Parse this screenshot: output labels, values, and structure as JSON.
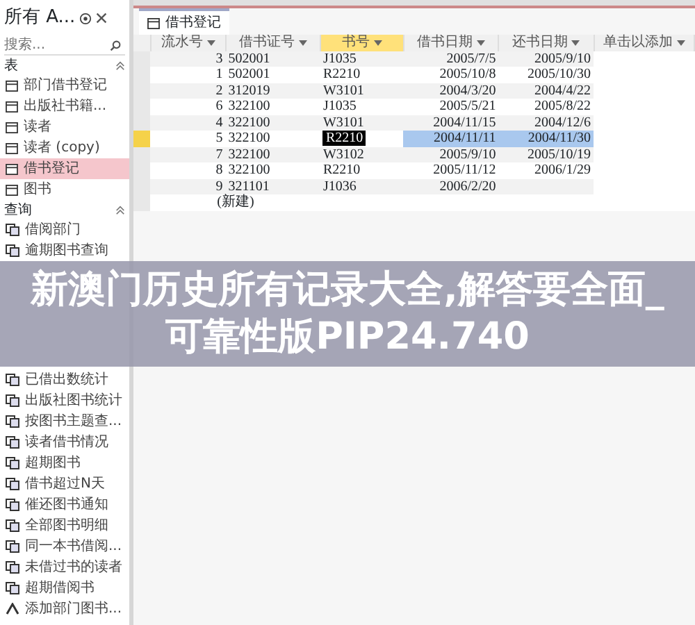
{
  "nav_pane": {
    "title": "所有 A...",
    "search": {
      "placeholder": "搜索..."
    },
    "groups": [
      {
        "label": "表",
        "expanded": true,
        "items": [
          {
            "label": "部门借书登记",
            "kind": "table",
            "selected": false
          },
          {
            "label": "出版社书籍...",
            "kind": "table",
            "selected": false
          },
          {
            "label": "读者",
            "kind": "table",
            "selected": false
          },
          {
            "label": "读者 (copy)",
            "kind": "table",
            "selected": false
          },
          {
            "label": "借书登记",
            "kind": "table",
            "selected": true
          },
          {
            "label": "图书",
            "kind": "table",
            "selected": false
          }
        ]
      },
      {
        "label": "查询",
        "expanded": true,
        "items": [
          {
            "label": "借阅部门",
            "kind": "query",
            "selected": false
          },
          {
            "label": "逾期图书查询",
            "kind": "query",
            "selected": false
          },
          {
            "label": "已借出数统计",
            "kind": "query",
            "selected": false
          },
          {
            "label": "出版社图书统计",
            "kind": "query",
            "selected": false
          },
          {
            "label": "按图书主题查...",
            "kind": "query",
            "selected": false
          },
          {
            "label": "读者借书情况",
            "kind": "query",
            "selected": false
          },
          {
            "label": "超期图书",
            "kind": "query",
            "selected": false
          },
          {
            "label": "借书超过N天",
            "kind": "query",
            "selected": false
          },
          {
            "label": "催还图书通知",
            "kind": "query",
            "selected": false
          },
          {
            "label": "全部图书明细",
            "kind": "query",
            "selected": false
          },
          {
            "label": "同一本书借阅...",
            "kind": "query",
            "selected": false
          },
          {
            "label": "未借过书的读者",
            "kind": "query",
            "selected": false
          },
          {
            "label": "超期借阅书",
            "kind": "query",
            "selected": false
          },
          {
            "label": "添加部门图书...",
            "kind": "action",
            "selected": false
          }
        ]
      }
    ]
  },
  "document_tab": {
    "label": "借书登记"
  },
  "table": {
    "columns": [
      {
        "label": "流水号",
        "selected": false
      },
      {
        "label": "借书证号",
        "selected": false
      },
      {
        "label": "书号",
        "selected": true
      },
      {
        "label": "借书日期",
        "selected": false
      },
      {
        "label": "还书日期",
        "selected": false
      },
      {
        "label": "单击以添加",
        "selected": false
      }
    ],
    "rows": [
      {
        "cells": [
          "3",
          "502001",
          "J1035",
          "2005/7/5",
          "2005/9/10"
        ],
        "selected": false
      },
      {
        "cells": [
          "1",
          "502001",
          "R2210",
          "2005/10/8",
          "2005/10/30"
        ],
        "selected": false
      },
      {
        "cells": [
          "2",
          "312019",
          "W3101",
          "2004/3/20",
          "2004/4/22"
        ],
        "selected": false
      },
      {
        "cells": [
          "6",
          "322100",
          "J1035",
          "2005/5/21",
          "2005/8/22"
        ],
        "selected": false
      },
      {
        "cells": [
          "4",
          "322100",
          "W3101",
          "2004/11/15",
          "2004/12/6"
        ],
        "selected": false
      },
      {
        "cells": [
          "5",
          "322100",
          "R2210",
          "2004/11/11",
          "2004/11/30"
        ],
        "selected": true
      },
      {
        "cells": [
          "7",
          "322100",
          "W3102",
          "2005/9/10",
          "2005/10/19"
        ],
        "selected": false
      },
      {
        "cells": [
          "8",
          "322100",
          "R2210",
          "2005/11/12",
          "2006/1/29"
        ],
        "selected": false
      },
      {
        "cells": [
          "9",
          "321101",
          "J1036",
          "2006/2/20",
          ""
        ],
        "selected": false
      }
    ],
    "new_row": "(新建)"
  },
  "banner": "新澳门历史所有记录大全,解答要全面_可靠性版PIP24.740"
}
